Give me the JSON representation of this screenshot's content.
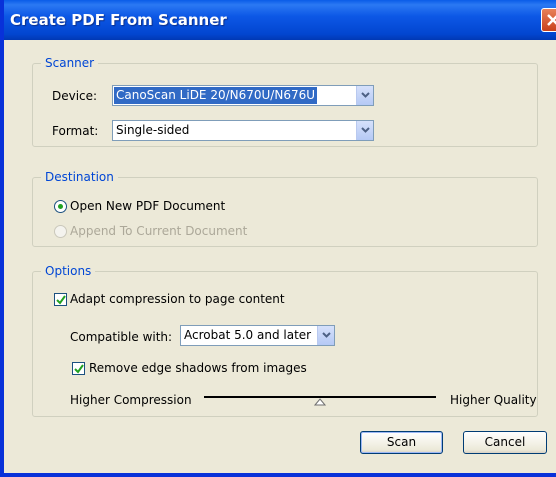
{
  "window": {
    "title": "Create PDF From Scanner"
  },
  "scanner": {
    "legend": "Scanner",
    "device_label": "Device:",
    "device_value": "CanoScan LiDE 20/N670U/N676U",
    "format_label": "Format:",
    "format_value": "Single-sided"
  },
  "destination": {
    "legend": "Destination",
    "option_new": "Open New PDF Document",
    "option_append": "Append To Current Document",
    "selected": "option_new"
  },
  "options": {
    "legend": "Options",
    "adapt_label": "Adapt compression to page content",
    "adapt_checked": true,
    "compat_label": "Compatible with:",
    "compat_value": "Acrobat 5.0 and later",
    "remove_shadows_label": "Remove edge shadows from images",
    "remove_shadows_checked": true,
    "slider_left": "Higher Compression",
    "slider_right": "Higher Quality",
    "slider_value": 0.5
  },
  "buttons": {
    "scan": "Scan",
    "cancel": "Cancel"
  },
  "colors": {
    "title_bar": "#0246d0",
    "legend": "#0046d5",
    "dialog_bg": "#ECE9D8"
  }
}
